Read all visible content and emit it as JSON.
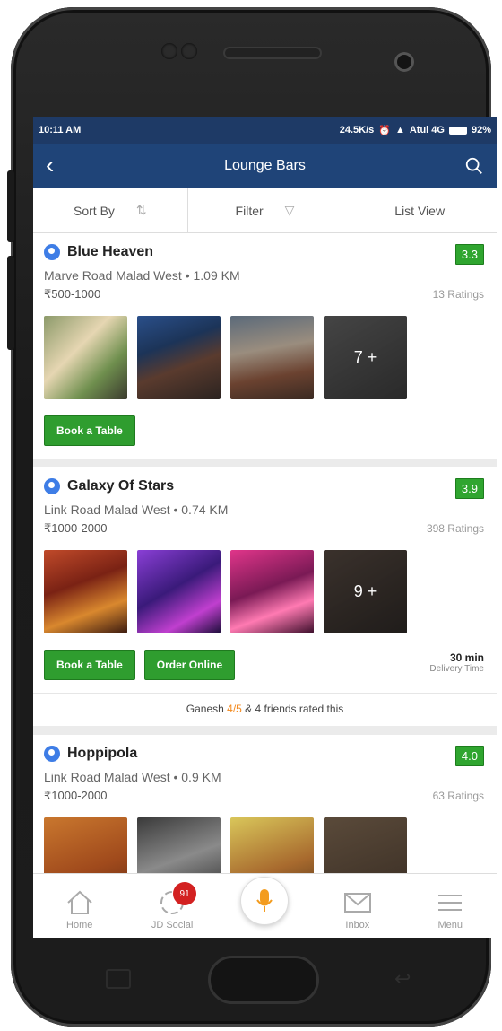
{
  "status_bar": {
    "time": "10:11 AM",
    "speed": "24.5K/s",
    "carrier": "Atul 4G",
    "battery": "92%"
  },
  "app_bar": {
    "title": "Lounge Bars",
    "back_icon": "chevron-left-icon",
    "search_icon": "search-icon"
  },
  "toolbar": {
    "sort_label": "Sort By",
    "filter_label": "Filter",
    "view_label": "List View"
  },
  "listings": [
    {
      "name": "Blue Heaven",
      "rating": "3.3",
      "address": "Marve Road Malad West • 1.09 KM",
      "price": "₹500-1000",
      "ratings_count": "13 Ratings",
      "more_photos": "7 +",
      "book_label": "Book a Table"
    },
    {
      "name": "Galaxy Of Stars",
      "rating": "3.9",
      "address": "Link Road Malad West • 0.74 KM",
      "price": "₹1000-2000",
      "ratings_count": "398 Ratings",
      "more_photos": "9 +",
      "book_label": "Book a Table",
      "order_label": "Order Online",
      "delivery_value": "30 min",
      "delivery_label": "Delivery Time",
      "friends_name": "Ganesh",
      "friends_rating": "4/5",
      "friends_rest": "& 4 friends rated this"
    },
    {
      "name": "Hoppipola",
      "rating": "4.0",
      "address": "Link Road Malad West • 0.9 KM",
      "price": "₹1000-2000",
      "ratings_count": "63 Ratings"
    }
  ],
  "bottom_nav": {
    "home": "Home",
    "social": "JD Social",
    "social_badge": "91",
    "inbox": "Inbox",
    "menu": "Menu"
  },
  "colors": {
    "app_bar": "#1f4478",
    "status_bar": "#1e3a66",
    "rating_green": "#2fa52f",
    "button_green": "#2f9d2f",
    "verify_blue": "#3e7de6",
    "mic_orange": "#f39c1f",
    "badge_red": "#d32121"
  }
}
